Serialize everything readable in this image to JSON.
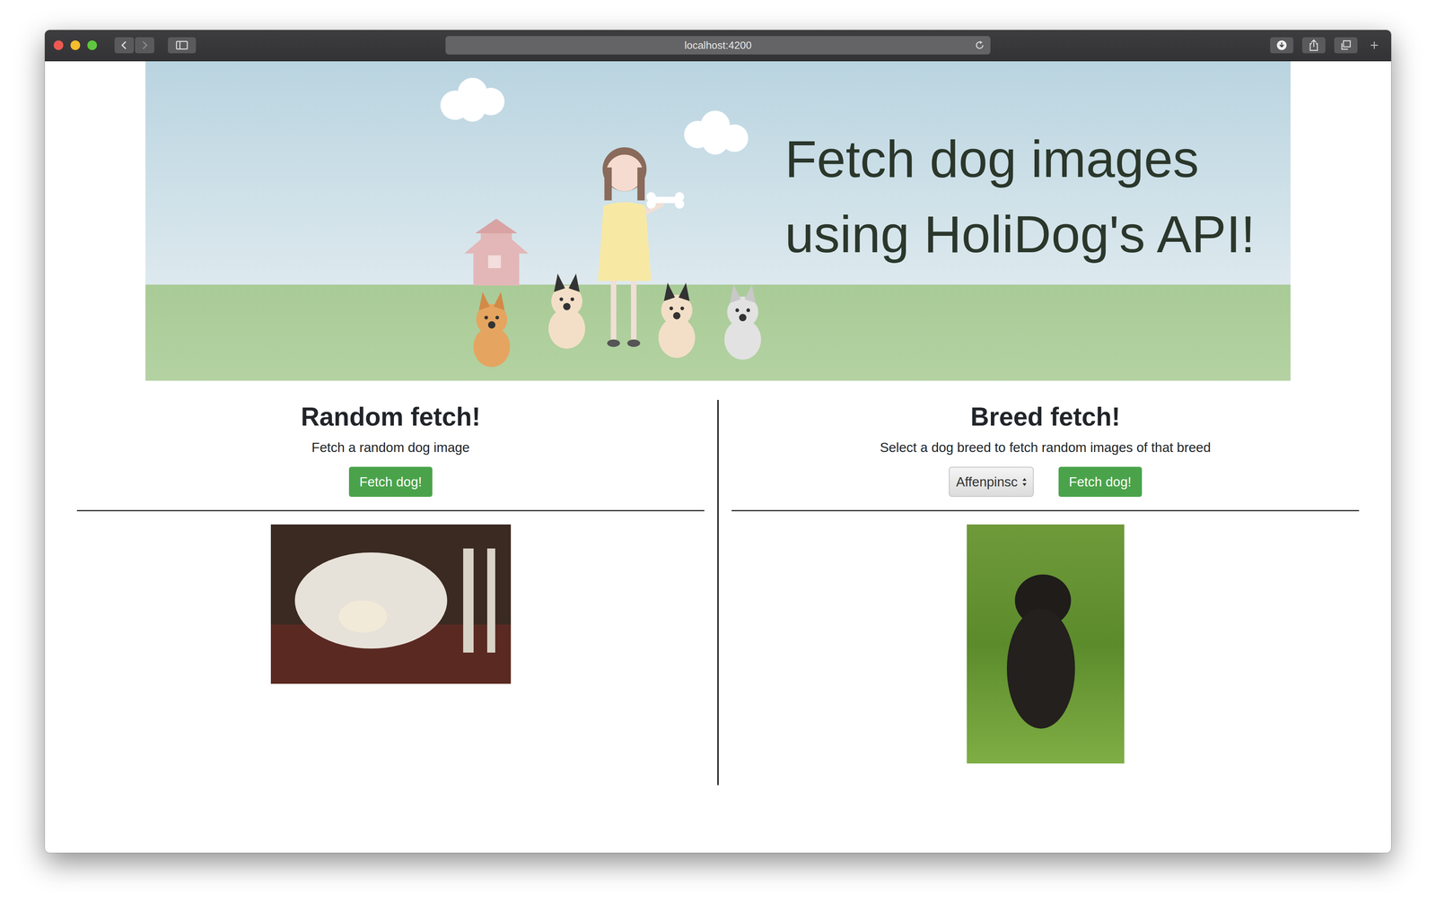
{
  "browser": {
    "url": "localhost:4200"
  },
  "hero": {
    "title": "Fetch dog images using HoliDog's API!"
  },
  "panels": [
    {
      "kind": "random",
      "title": "Random fetch!",
      "description": "Fetch a random dog image",
      "button": "Fetch dog!"
    },
    {
      "kind": "breed",
      "title": "Breed fetch!",
      "description": "Select a dog breed to fetch random images of that breed",
      "select": {
        "value": "Affenpinsc"
      },
      "button": "Fetch dog!"
    }
  ]
}
